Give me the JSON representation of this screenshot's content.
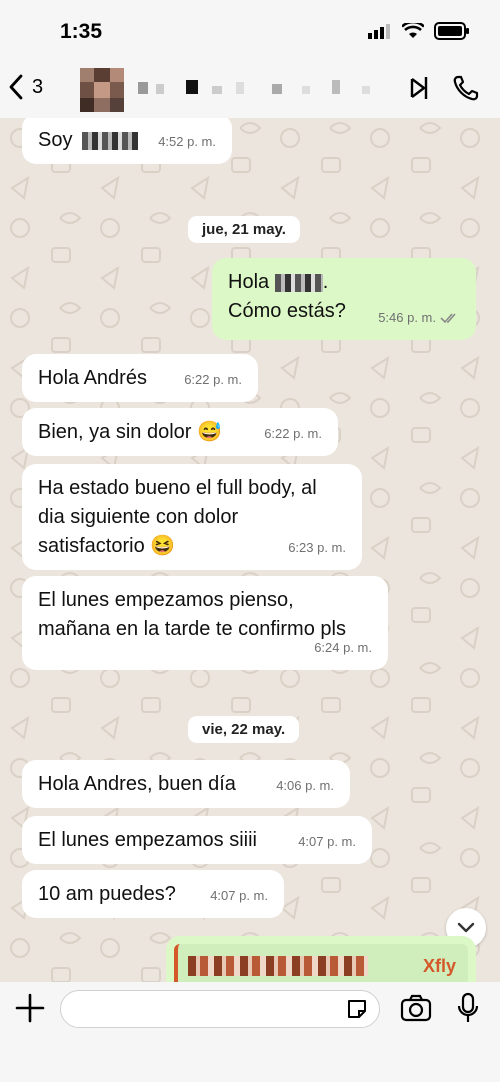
{
  "status": {
    "time": "1:35"
  },
  "header": {
    "back_count": "3"
  },
  "messages": [
    {
      "id": "m1",
      "text": "Soy",
      "time": "4:52 p. m."
    },
    {
      "id": "m2",
      "line1": "Hola",
      "line1_suffix": ".",
      "line2": "Cómo estás?",
      "time": "5:46 p. m."
    },
    {
      "id": "m3",
      "text": "Hola Andrés",
      "time": "6:22 p. m."
    },
    {
      "id": "m4",
      "text": "Bien, ya sin dolor 😅",
      "time": "6:22 p. m."
    },
    {
      "id": "m5",
      "line1": "Ha estado bueno el full body, al",
      "line2": "dia siguiente con dolor",
      "line3": "satisfactorio 😆",
      "time": "6:23 p. m."
    },
    {
      "id": "m6",
      "line1": "El lunes empezamos pienso,",
      "line2": "mañana en la tarde te confirmo pls",
      "time": "6:24 p. m."
    },
    {
      "id": "m7",
      "text": "Hola Andres, buen día",
      "time": "4:06 p. m."
    },
    {
      "id": "m8",
      "text": "El lunes empezamos siiii",
      "time": "4:07 p. m."
    },
    {
      "id": "m9",
      "text": "10 am puedes?",
      "time": "4:07 p. m."
    }
  ],
  "dates": {
    "d1": "jue, 21 may.",
    "d2": "vie, 22 may."
  },
  "reply_preview": {
    "name": "Xfly"
  },
  "colors": {
    "outgoing": "#dcf8c6",
    "incoming": "#ffffff",
    "chat_bg": "#ece5dd",
    "accent": "#d4582a"
  },
  "icons": [
    "back-chevron-icon",
    "phone-icon",
    "video-call-icon",
    "plus-icon",
    "sticker-icon",
    "camera-icon",
    "microphone-icon",
    "chevron-down-icon",
    "double-check-icon"
  ]
}
